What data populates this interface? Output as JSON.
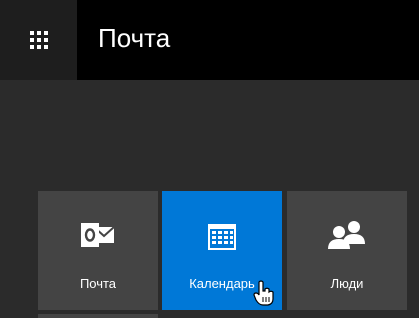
{
  "header": {
    "app_title": "Почта",
    "launcher_icon": "app-launcher-waffle-icon",
    "background": "#000000"
  },
  "tiles": [
    {
      "label": "Почта",
      "icon": "outlook-mail-icon",
      "selected": false
    },
    {
      "label": "Календарь",
      "icon": "calendar-icon",
      "selected": true
    },
    {
      "label": "Люди",
      "icon": "people-icon",
      "selected": false
    }
  ],
  "colors": {
    "accent": "#0078d7",
    "tile": "#444444",
    "panel": "#2b2b2b"
  }
}
